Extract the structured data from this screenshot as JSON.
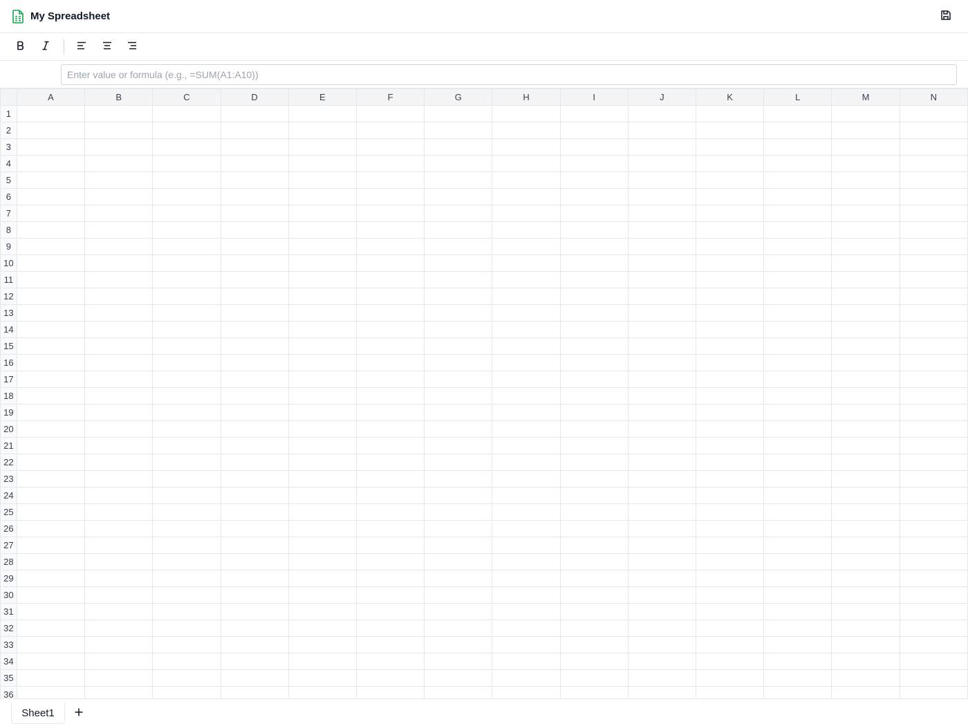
{
  "app": {
    "title": "My Spreadsheet",
    "icon": "spreadsheet-doc-icon",
    "accent_color": "#16a34a"
  },
  "toolbar": {
    "buttons": [
      {
        "name": "bold-button",
        "icon": "bold-icon"
      },
      {
        "name": "italic-button",
        "icon": "italic-icon"
      },
      {
        "name": "align-left-button",
        "icon": "align-left-icon"
      },
      {
        "name": "align-center-button",
        "icon": "align-center-icon"
      },
      {
        "name": "align-right-button",
        "icon": "align-right-icon"
      }
    ],
    "save_icon": "save-icon"
  },
  "formula_bar": {
    "value": "",
    "placeholder": "Enter value or formula (e.g., =SUM(A1:A10))"
  },
  "grid": {
    "columns": [
      "A",
      "B",
      "C",
      "D",
      "E",
      "F",
      "G",
      "H",
      "I",
      "J",
      "K",
      "L",
      "M",
      "N"
    ],
    "rows": [
      "1",
      "2",
      "3",
      "4",
      "5",
      "6",
      "7",
      "8",
      "9",
      "10",
      "11",
      "12",
      "13",
      "14",
      "15",
      "16",
      "17",
      "18",
      "19",
      "20",
      "21",
      "22",
      "23",
      "24",
      "25",
      "26",
      "27",
      "28",
      "29",
      "30",
      "31",
      "32",
      "33",
      "34",
      "35",
      "36"
    ]
  },
  "sheets": {
    "tabs": [
      {
        "label": "Sheet1",
        "active": true
      }
    ],
    "add_icon": "plus-icon"
  }
}
